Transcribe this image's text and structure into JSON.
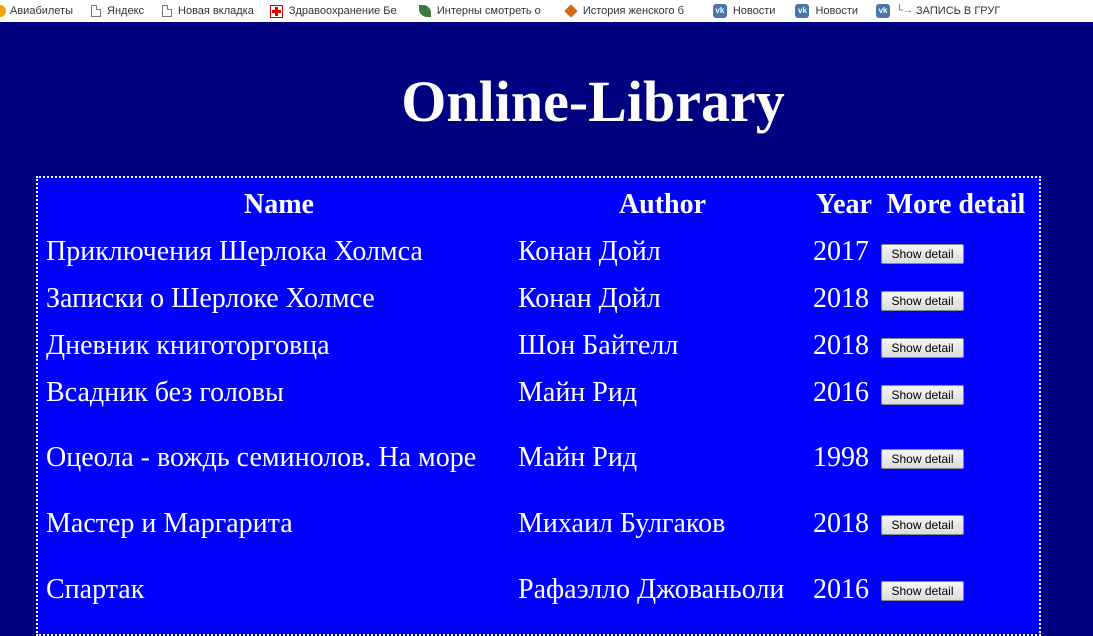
{
  "bookmarks": [
    {
      "label": "Авиабилеты",
      "icon": "plane-icon"
    },
    {
      "label": "Яндекс",
      "icon": "page-icon"
    },
    {
      "label": "Новая вкладка",
      "icon": "page-icon"
    },
    {
      "label": "Здравоохранение Бе",
      "icon": "medical-cross-icon"
    },
    {
      "label": "Интерны смотреть о",
      "icon": "leaf-icon"
    },
    {
      "label": "История женского б",
      "icon": "tag-icon"
    },
    {
      "label": "Новости",
      "icon": "vk-icon"
    },
    {
      "label": "Новости",
      "icon": "vk-icon"
    },
    {
      "label": "ЗАПИСЬ В ГРУГ",
      "icon": "vk-icon"
    }
  ],
  "bookmark_extra_icon": "arrow-icon",
  "vk_glyph": "vk",
  "page": {
    "title": "Online-Library"
  },
  "table": {
    "headers": {
      "name": "Name",
      "author": "Author",
      "year": "Year",
      "more": "More detail"
    },
    "button_label": "Show detail",
    "rows": [
      {
        "name": "Приключения Шерлока Холмса",
        "author": "Конан Дойл",
        "year": "2017"
      },
      {
        "name": "Записки о Шерлоке Холмсе",
        "author": "Конан Дойл",
        "year": "2018"
      },
      {
        "name": "Дневник книготорговца",
        "author": "Шон Байтелл",
        "year": "2018"
      },
      {
        "name": "Всадник без головы",
        "author": "Майн Рид",
        "year": "2016"
      },
      {
        "name": "Оцеола - вождь семинолов. На море",
        "author": "Майн Рид",
        "year": "1998"
      },
      {
        "name": "Мастер и Маргарита",
        "author": "Михаил Булгаков",
        "year": "2018"
      },
      {
        "name": "Спартак",
        "author": "Рафаэлло Джованьоли",
        "year": "2016"
      }
    ]
  },
  "colors": {
    "page_background": "#000080",
    "table_background": "#0000ff",
    "text": "#ffffff"
  }
}
